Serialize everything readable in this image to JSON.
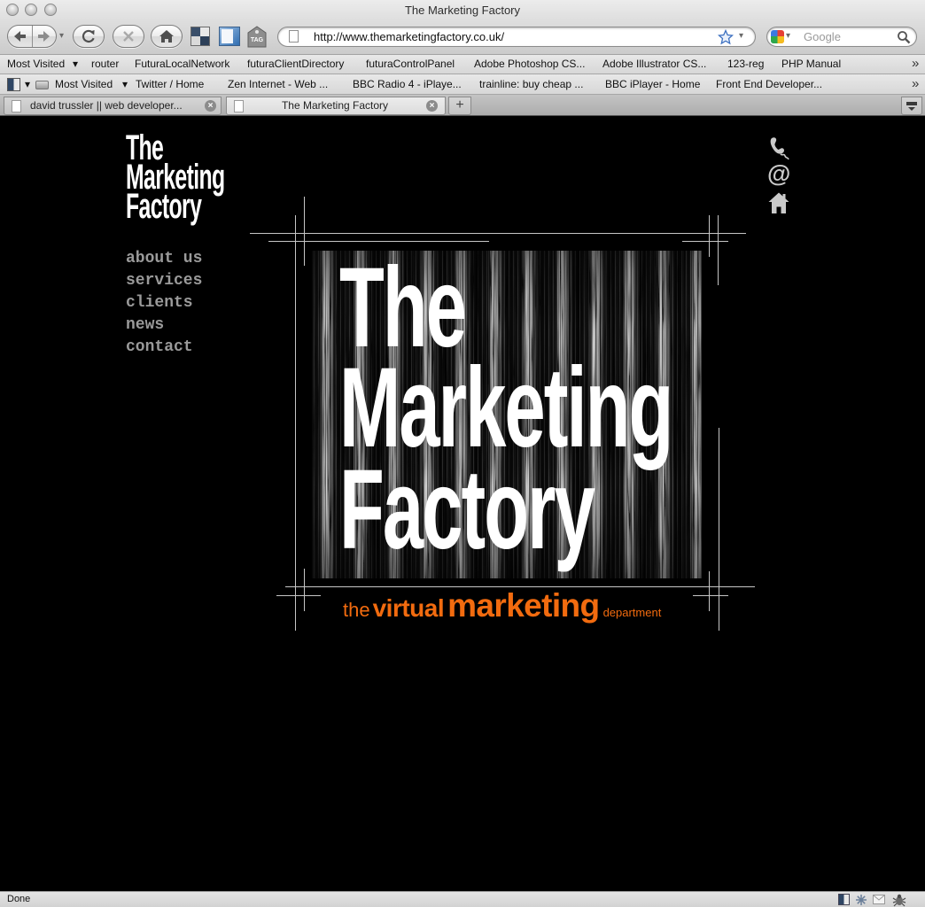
{
  "window": {
    "title": "The Marketing Factory",
    "controls": [
      "close-icon",
      "minimize-icon",
      "zoom-icon"
    ]
  },
  "toolbar": {
    "buttons": [
      "back-arrow-icon",
      "forward-arrow-icon",
      "history-dropdown-icon",
      "reload-icon",
      "stop-icon",
      "home-icon",
      "bookmark-manager-icon",
      "sidebar-icon",
      "tag-icon"
    ],
    "tag_icon_text": "TAG",
    "history_caret": "▾",
    "url": "http://www.themarketingfactory.co.uk/",
    "url_icons": [
      "page-icon",
      "star-icon",
      "url-dropdown-icon"
    ],
    "search_placeholder": "Google",
    "search_icons": [
      "google-icon",
      "magnifier-icon"
    ],
    "search_engine_caret": "▾"
  },
  "bookmarks_bar_1": {
    "items": [
      {
        "label": "Most Visited",
        "dropdown": "▾"
      },
      {
        "label": "router"
      },
      {
        "label": "FuturaLocalNetwork"
      },
      {
        "label": "futuraClientDirectory"
      },
      {
        "label": "futuraControlPanel"
      },
      {
        "label": "Adobe Photoshop CS..."
      },
      {
        "label": "Adobe Illustrator CS..."
      },
      {
        "label": "123-reg"
      },
      {
        "label": "PHP Manual"
      }
    ],
    "overflow": "»"
  },
  "bookmarks_bar_2": {
    "menu_caret": "▾",
    "items": [
      {
        "label": "Most Visited",
        "dropdown": "▾"
      },
      {
        "label": "Twitter / Home"
      },
      {
        "label": "Zen Internet - Web ..."
      },
      {
        "label": "BBC Radio 4 - iPlaye..."
      },
      {
        "label": "trainline: buy cheap ..."
      },
      {
        "label": "BBC iPlayer - Home"
      },
      {
        "label": "Front End Developer..."
      }
    ],
    "overflow": "»"
  },
  "tabs": [
    {
      "label": "david trussler || web developer...",
      "active": false,
      "close": "×"
    },
    {
      "label": "The Marketing Factory",
      "active": true,
      "close": "×"
    }
  ],
  "tab_controls": {
    "new_tab": "+",
    "list_tabs_icon": "tab-list-icon"
  },
  "page": {
    "logo": {
      "lines": [
        "The",
        "Marketing",
        "Factory"
      ]
    },
    "nav": [
      {
        "label": "about us"
      },
      {
        "label": "services"
      },
      {
        "label": "clients"
      },
      {
        "label": "news"
      },
      {
        "label": "contact"
      }
    ],
    "contact_icons": [
      {
        "name": "phone-icon"
      },
      {
        "name": "email-icon",
        "glyph": "@"
      },
      {
        "name": "home-icon"
      }
    ],
    "hero": {
      "headline": [
        "The",
        "Marketing",
        "Factory"
      ],
      "tagline": [
        "the",
        "virtual",
        "marketing",
        "department"
      ]
    }
  },
  "status_bar": {
    "text": "Done",
    "icons": [
      "extension-icon",
      "snowflake-icon",
      "mail-icon",
      "firebug-icon"
    ]
  },
  "colors": {
    "page_background": "#000000",
    "logo_text": "#ffffff",
    "nav_text": "#9a9a9a",
    "tagline_orange": "#f26b0f",
    "crop_marks": "#c6c6c6"
  }
}
